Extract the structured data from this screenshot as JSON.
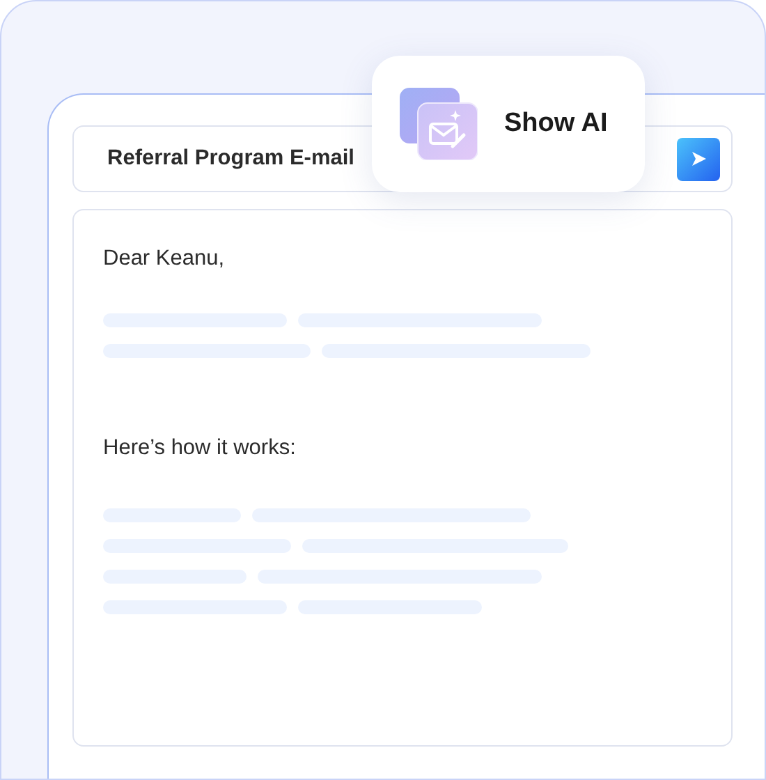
{
  "email": {
    "subject": "Referral Program E-mail",
    "body": [
      {
        "kind": "text",
        "text": "Dear Keanu,"
      },
      {
        "kind": "placeholder"
      },
      {
        "kind": "text",
        "text": "Here’s how it works:"
      },
      {
        "kind": "placeholder"
      }
    ]
  },
  "popup": {
    "label": "Show AI"
  }
}
